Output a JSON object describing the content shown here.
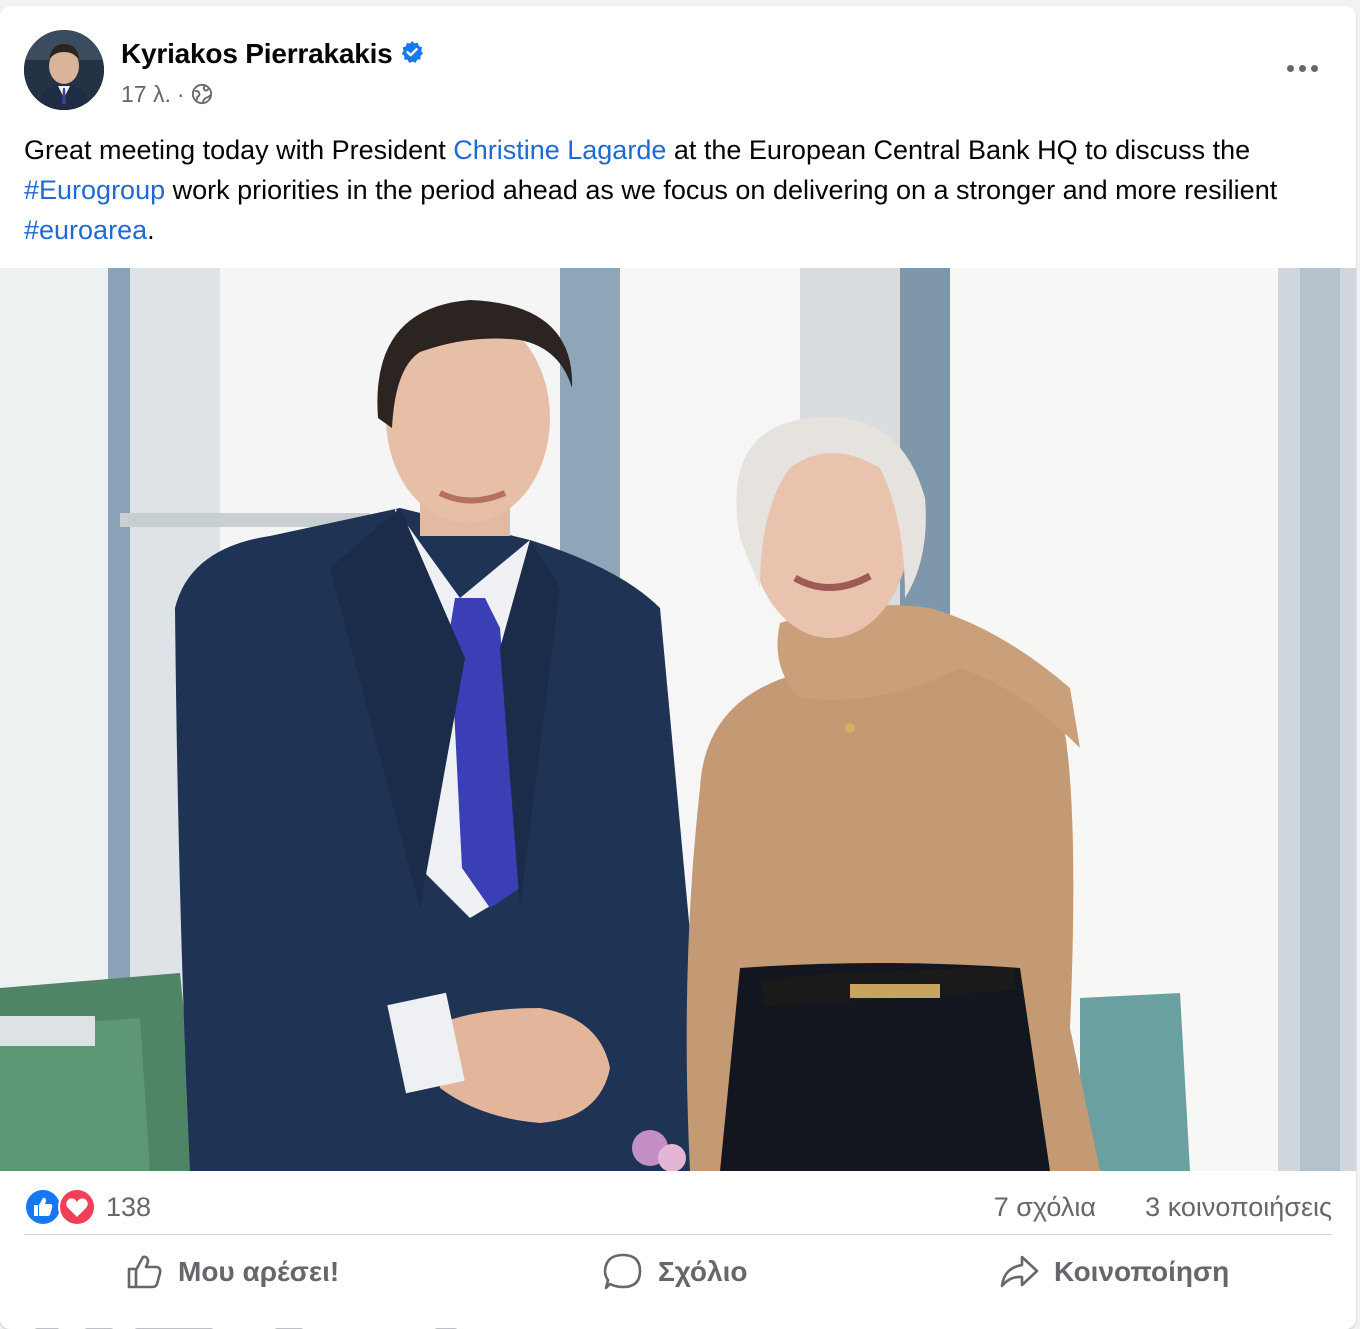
{
  "post": {
    "author": "Kyriakos Pierrakakis",
    "verified_icon": "verified-badge-icon",
    "timestamp": "17 λ.",
    "separator": "·",
    "audience_icon": "globe-icon",
    "text": {
      "part1": "Great meeting today with President ",
      "mention": "Christine Lagarde",
      "part2": " at the European Central Bank HQ to discuss the ",
      "hashtag1": "#Eurogroup",
      "part3": " work priorities in the period ahead as we focus on delivering on a stronger and more resilient ",
      "hashtag2": "#euroarea",
      "part4": "."
    },
    "link_color": "#1d6ad6"
  },
  "stats": {
    "reaction_icons": [
      "like-reaction-icon",
      "love-reaction-icon"
    ],
    "reactions_count": "138",
    "comments": "7 σχόλια",
    "shares": "3 κοινοποιήσεις"
  },
  "actions": {
    "like": "Μου αρέσει!",
    "comment": "Σχόλιο",
    "share": "Κοινοποίηση"
  },
  "colors": {
    "accent": "#1877f2",
    "love": "#f33e58",
    "secondary_text": "#65676b"
  }
}
